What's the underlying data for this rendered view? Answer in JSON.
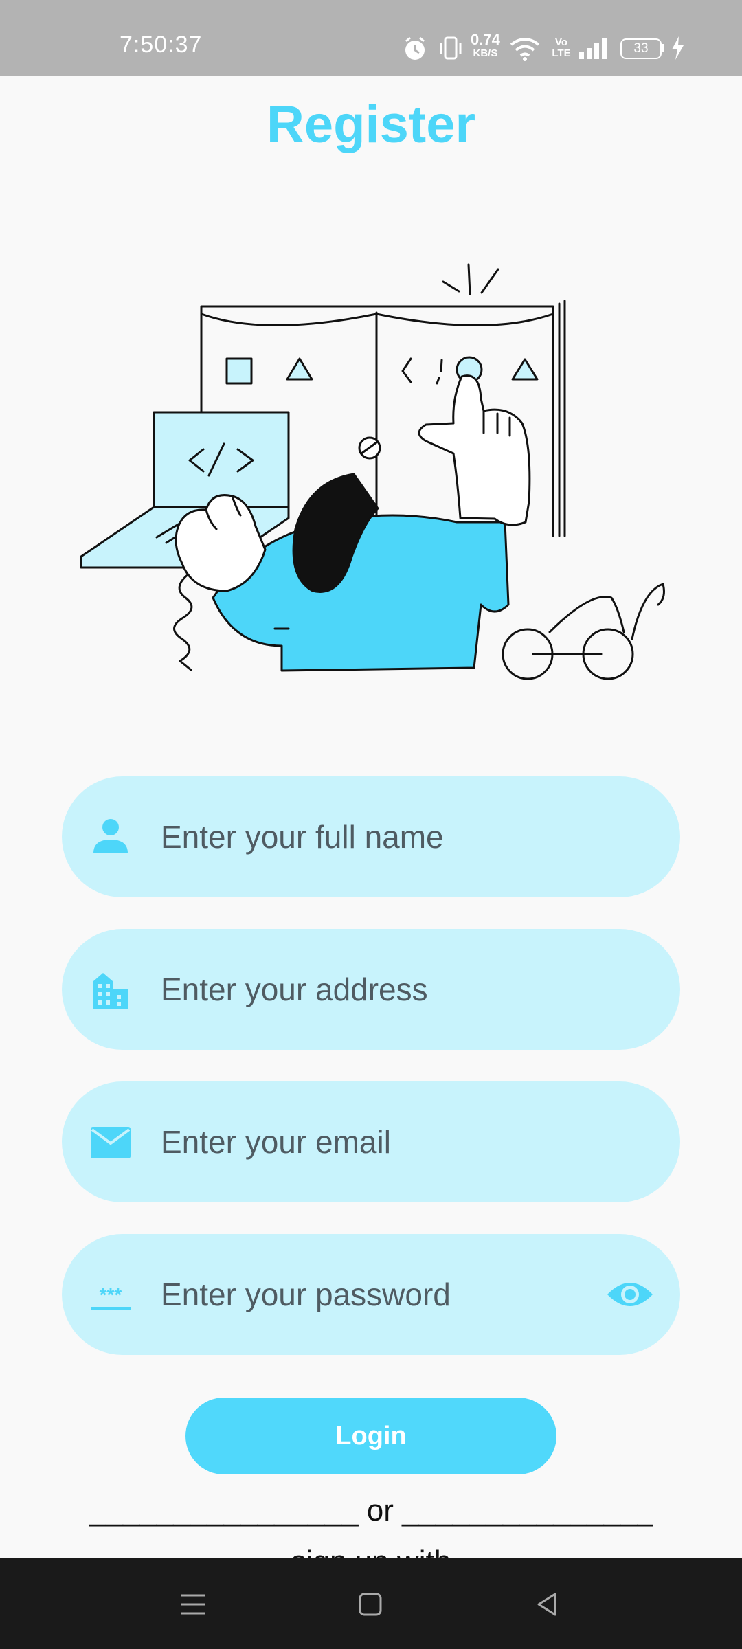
{
  "status_bar": {
    "time": "7:50:37",
    "network_speed": "0.74",
    "network_speed_unit": "KB/S",
    "volte_label": "Vo LTE",
    "battery": "33"
  },
  "page": {
    "title": "Register"
  },
  "form": {
    "name_placeholder": "Enter your full name",
    "address_placeholder": "Enter your address",
    "email_placeholder": "Enter your email",
    "password_placeholder": "Enter your password",
    "password_mask_icon_label": "***"
  },
  "actions": {
    "login_label": "Login",
    "or_divider": "________________ or ________________",
    "alt_text_cut": "sign up with"
  },
  "colors": {
    "accent": "#4dd6f9",
    "field_bg": "#c8f3fc",
    "button_bg": "#50d8fb",
    "status_bar_bg": "#b3b3b3",
    "nav_bar_bg": "#1a1a1a"
  },
  "icons": {
    "name": "person-icon",
    "address": "building-icon",
    "email": "mail-icon",
    "password": "password-mask-icon",
    "visibility": "eye-icon"
  }
}
